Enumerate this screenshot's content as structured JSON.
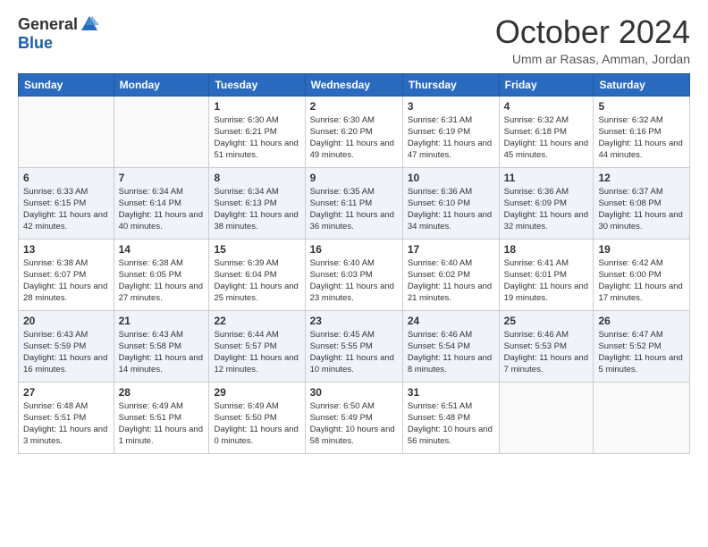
{
  "logo": {
    "general": "General",
    "blue": "Blue"
  },
  "title": "October 2024",
  "location": "Umm ar Rasas, Amman, Jordan",
  "headers": [
    "Sunday",
    "Monday",
    "Tuesday",
    "Wednesday",
    "Thursday",
    "Friday",
    "Saturday"
  ],
  "weeks": [
    [
      {
        "day": "",
        "text": ""
      },
      {
        "day": "",
        "text": ""
      },
      {
        "day": "1",
        "text": "Sunrise: 6:30 AM\nSunset: 6:21 PM\nDaylight: 11 hours and 51 minutes."
      },
      {
        "day": "2",
        "text": "Sunrise: 6:30 AM\nSunset: 6:20 PM\nDaylight: 11 hours and 49 minutes."
      },
      {
        "day": "3",
        "text": "Sunrise: 6:31 AM\nSunset: 6:19 PM\nDaylight: 11 hours and 47 minutes."
      },
      {
        "day": "4",
        "text": "Sunrise: 6:32 AM\nSunset: 6:18 PM\nDaylight: 11 hours and 45 minutes."
      },
      {
        "day": "5",
        "text": "Sunrise: 6:32 AM\nSunset: 6:16 PM\nDaylight: 11 hours and 44 minutes."
      }
    ],
    [
      {
        "day": "6",
        "text": "Sunrise: 6:33 AM\nSunset: 6:15 PM\nDaylight: 11 hours and 42 minutes."
      },
      {
        "day": "7",
        "text": "Sunrise: 6:34 AM\nSunset: 6:14 PM\nDaylight: 11 hours and 40 minutes."
      },
      {
        "day": "8",
        "text": "Sunrise: 6:34 AM\nSunset: 6:13 PM\nDaylight: 11 hours and 38 minutes."
      },
      {
        "day": "9",
        "text": "Sunrise: 6:35 AM\nSunset: 6:11 PM\nDaylight: 11 hours and 36 minutes."
      },
      {
        "day": "10",
        "text": "Sunrise: 6:36 AM\nSunset: 6:10 PM\nDaylight: 11 hours and 34 minutes."
      },
      {
        "day": "11",
        "text": "Sunrise: 6:36 AM\nSunset: 6:09 PM\nDaylight: 11 hours and 32 minutes."
      },
      {
        "day": "12",
        "text": "Sunrise: 6:37 AM\nSunset: 6:08 PM\nDaylight: 11 hours and 30 minutes."
      }
    ],
    [
      {
        "day": "13",
        "text": "Sunrise: 6:38 AM\nSunset: 6:07 PM\nDaylight: 11 hours and 28 minutes."
      },
      {
        "day": "14",
        "text": "Sunrise: 6:38 AM\nSunset: 6:05 PM\nDaylight: 11 hours and 27 minutes."
      },
      {
        "day": "15",
        "text": "Sunrise: 6:39 AM\nSunset: 6:04 PM\nDaylight: 11 hours and 25 minutes."
      },
      {
        "day": "16",
        "text": "Sunrise: 6:40 AM\nSunset: 6:03 PM\nDaylight: 11 hours and 23 minutes."
      },
      {
        "day": "17",
        "text": "Sunrise: 6:40 AM\nSunset: 6:02 PM\nDaylight: 11 hours and 21 minutes."
      },
      {
        "day": "18",
        "text": "Sunrise: 6:41 AM\nSunset: 6:01 PM\nDaylight: 11 hours and 19 minutes."
      },
      {
        "day": "19",
        "text": "Sunrise: 6:42 AM\nSunset: 6:00 PM\nDaylight: 11 hours and 17 minutes."
      }
    ],
    [
      {
        "day": "20",
        "text": "Sunrise: 6:43 AM\nSunset: 5:59 PM\nDaylight: 11 hours and 16 minutes."
      },
      {
        "day": "21",
        "text": "Sunrise: 6:43 AM\nSunset: 5:58 PM\nDaylight: 11 hours and 14 minutes."
      },
      {
        "day": "22",
        "text": "Sunrise: 6:44 AM\nSunset: 5:57 PM\nDaylight: 11 hours and 12 minutes."
      },
      {
        "day": "23",
        "text": "Sunrise: 6:45 AM\nSunset: 5:55 PM\nDaylight: 11 hours and 10 minutes."
      },
      {
        "day": "24",
        "text": "Sunrise: 6:46 AM\nSunset: 5:54 PM\nDaylight: 11 hours and 8 minutes."
      },
      {
        "day": "25",
        "text": "Sunrise: 6:46 AM\nSunset: 5:53 PM\nDaylight: 11 hours and 7 minutes."
      },
      {
        "day": "26",
        "text": "Sunrise: 6:47 AM\nSunset: 5:52 PM\nDaylight: 11 hours and 5 minutes."
      }
    ],
    [
      {
        "day": "27",
        "text": "Sunrise: 6:48 AM\nSunset: 5:51 PM\nDaylight: 11 hours and 3 minutes."
      },
      {
        "day": "28",
        "text": "Sunrise: 6:49 AM\nSunset: 5:51 PM\nDaylight: 11 hours and 1 minute."
      },
      {
        "day": "29",
        "text": "Sunrise: 6:49 AM\nSunset: 5:50 PM\nDaylight: 11 hours and 0 minutes."
      },
      {
        "day": "30",
        "text": "Sunrise: 6:50 AM\nSunset: 5:49 PM\nDaylight: 10 hours and 58 minutes."
      },
      {
        "day": "31",
        "text": "Sunrise: 6:51 AM\nSunset: 5:48 PM\nDaylight: 10 hours and 56 minutes."
      },
      {
        "day": "",
        "text": ""
      },
      {
        "day": "",
        "text": ""
      }
    ]
  ]
}
